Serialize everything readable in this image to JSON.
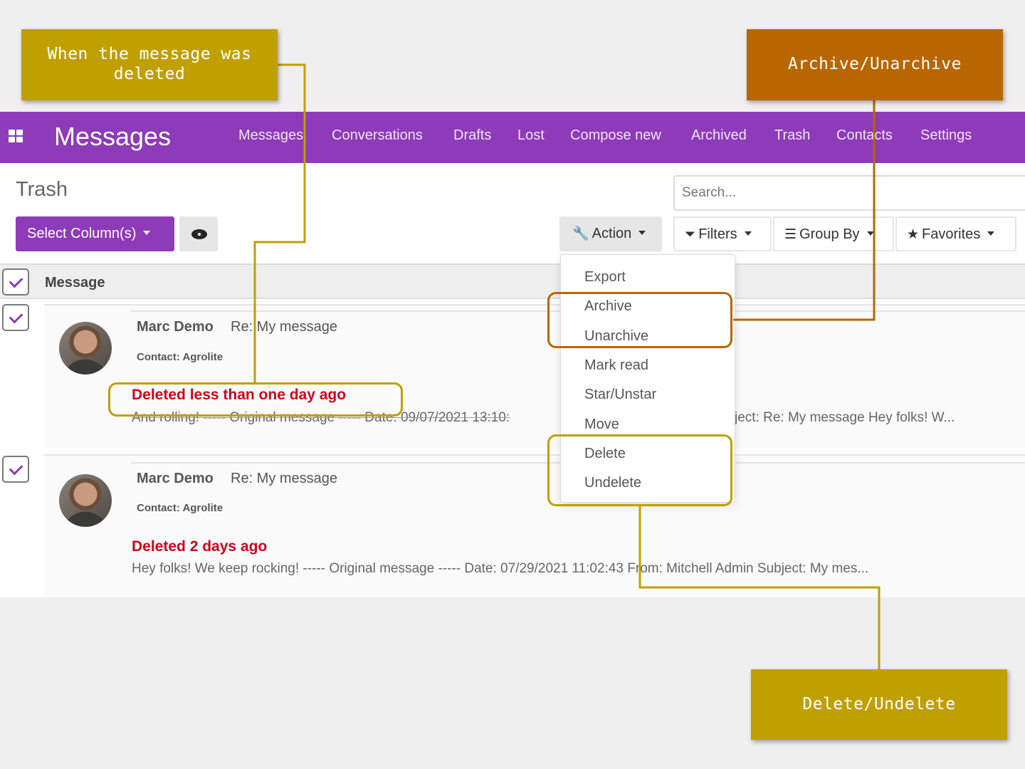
{
  "navbar": {
    "brand": "Messages",
    "items": [
      "Messages",
      "Conversations",
      "Drafts",
      "Lost",
      "Compose new",
      "Archived",
      "Trash",
      "Contacts",
      "Settings"
    ]
  },
  "page": {
    "title": "Trash",
    "search_placeholder": "Search..."
  },
  "toolbar": {
    "select_columns": "Select Column(s)",
    "action": "Action",
    "filters": "Filters",
    "group_by": "Group By",
    "favorites": "Favorites"
  },
  "table": {
    "header": "Message",
    "rows": [
      {
        "sender": "Marc Demo",
        "subject": "Re: My message",
        "contact": "Contact: Agrolite",
        "deleted": "Deleted less than one day ago",
        "preview_left": "And rolling! ----- Original message ----- Date: 09/07/2021 13:10:",
        "preview_right": "ject: Re: My message Hey folks! W..."
      },
      {
        "sender": "Marc Demo",
        "subject": "Re: My message",
        "contact": "Contact: Agrolite",
        "deleted": "Deleted 2 days ago",
        "preview": "Hey folks! We keep rocking! ----- Original message ----- Date: 07/29/2021 11:02:43 From: Mitchell Admin Subject: My mes..."
      }
    ]
  },
  "action_menu": [
    "Export",
    "Archive",
    "Unarchive",
    "Mark read",
    "Star/Unstar",
    "Move",
    "Delete",
    "Undelete"
  ],
  "annotations": {
    "deleted_when": "When the message was deleted",
    "archive": "Archive/Unarchive",
    "delete": "Delete/Undelete"
  },
  "colors": {
    "brand": "#8d3bb8",
    "deleted_text": "#d0021b",
    "callout_olive": "#bfa000",
    "callout_orange": "#b86600"
  },
  "icons": [
    "apps-grid-icon",
    "eye-icon",
    "wrench-icon",
    "filter-icon",
    "bars-icon",
    "star-icon",
    "check-icon",
    "caret-down-icon"
  ]
}
